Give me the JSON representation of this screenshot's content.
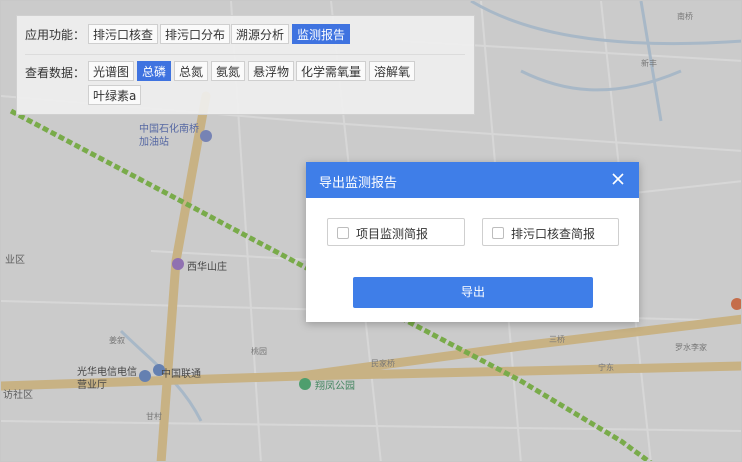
{
  "toolbar": {
    "app_label": "应用功能：",
    "data_label": "查看数据：",
    "functions": [
      "排污口核查",
      "排污口分布",
      "溯源分析",
      "监测报告"
    ],
    "active_function": "监测报告",
    "layers": [
      "光谱图",
      "总磷",
      "总氮",
      "氨氮",
      "悬浮物",
      "化学需氧量",
      "溶解氧",
      "叶绿素a"
    ],
    "active_layer": "总磷"
  },
  "map": {
    "labels": {
      "gas_station": "中国石化南桥\n加油站",
      "xihua": "西华山庄",
      "guanghua": "光华电信电信\n营业厅",
      "unicom": "中国联通",
      "park": "翔凤公园",
      "qu": "业区",
      "she": "访社区",
      "nanqiao": "南桥",
      "xinfeng": "新丰",
      "jiangxu": "姜叙",
      "taoyuan": "桃园",
      "luoshui": "罗水李家",
      "sanqiao": "三桥",
      "ningdong": "宁东",
      "gancun": "甘村",
      "shayi": "沙宜",
      "minjiaqiao": "民家桥"
    },
    "colors": {
      "river_green": "#7bbf3a",
      "road": "#e7c98b",
      "land": "#ebebeb"
    }
  },
  "modal": {
    "title": "导出监测报告",
    "option1": "项目监测简报",
    "option2": "排污口核查简报",
    "export_label": "导出"
  }
}
